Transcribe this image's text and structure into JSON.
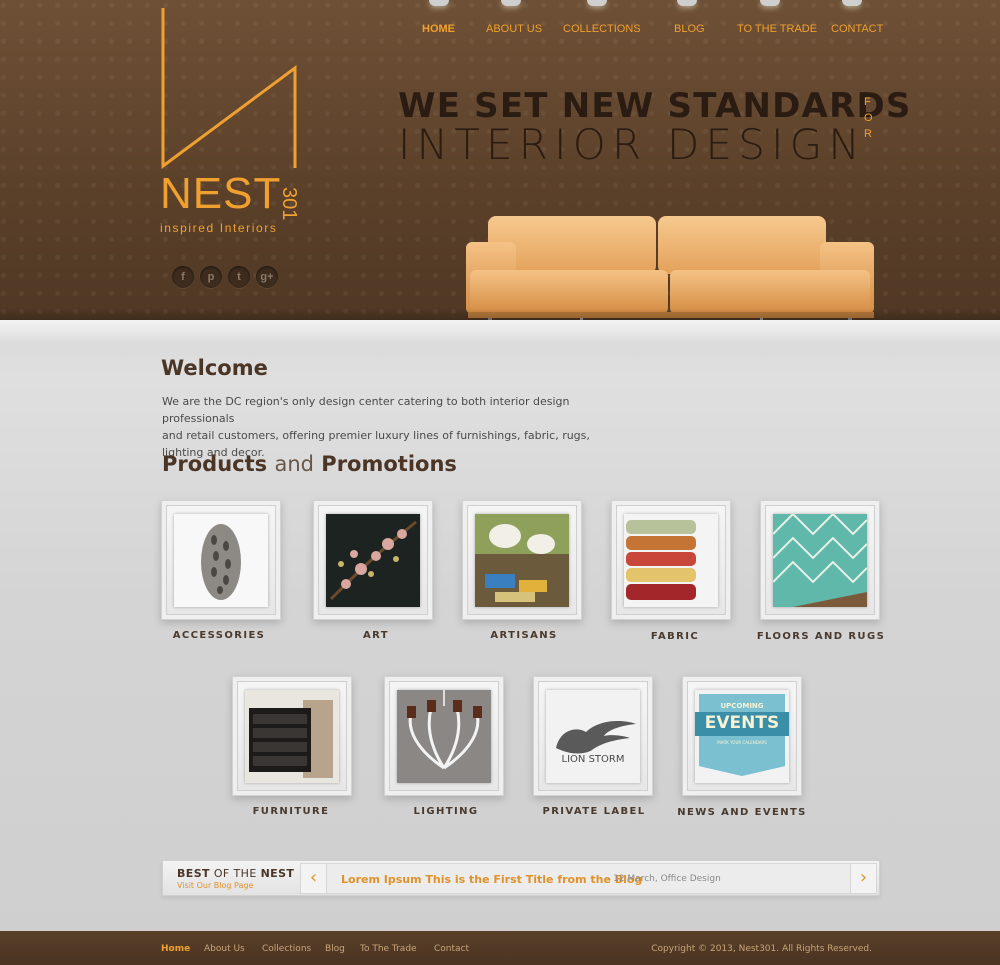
{
  "brand": {
    "name": "NEST",
    "number": "301",
    "tagline": "inspired Interiors",
    "accent": "#f0a030",
    "background": "#5b4029"
  },
  "social": [
    {
      "name": "facebook-icon",
      "glyph": "f"
    },
    {
      "name": "pinterest-icon",
      "glyph": "p"
    },
    {
      "name": "twitter-icon",
      "glyph": "t"
    },
    {
      "name": "google-plus-icon",
      "glyph": "g+"
    }
  ],
  "nav": {
    "items": [
      {
        "label": "HOME",
        "active": true
      },
      {
        "label": "ABOUT US",
        "active": false
      },
      {
        "label": "COLLECTIONS",
        "active": false
      },
      {
        "label": "BLOG",
        "active": false
      },
      {
        "label": "TO THE TRADE",
        "active": false
      },
      {
        "label": "CONTACT",
        "active": false
      }
    ]
  },
  "hero": {
    "line1": "WE SET NEW STANDARDS",
    "line2": "INTERIOR DESIGN",
    "vertical": "FOR"
  },
  "welcome": {
    "title": "Welcome",
    "line1": "We are the DC region's only design center catering to both interior design professionals",
    "line2": "and retail customers, offering premier luxury lines of furnishings, fabric, rugs, lighting and decor."
  },
  "products": {
    "title_bold1": "Products",
    "title_light": "and",
    "title_bold2": "Promotions",
    "items": [
      {
        "label": "ACCESSORIES"
      },
      {
        "label": "ART"
      },
      {
        "label": "ARTISANS"
      },
      {
        "label": "FABRIC"
      },
      {
        "label": "FLOORS AND RUGS"
      },
      {
        "label": "FURNITURE"
      },
      {
        "label": "LIGHTING"
      },
      {
        "label": "PRIVATE LABEL",
        "logo_text": "LION STORM"
      },
      {
        "label": "NEWS AND EVENTS",
        "badge_top": "UPCOMING",
        "badge_main": "EVENTS",
        "badge_sub": "MARK YOUR CALENDARS"
      }
    ]
  },
  "blog": {
    "best_bold1": "BEST",
    "best_light": "OF THE",
    "best_bold2": "NEST",
    "visit": "Visit Our Blog Page",
    "headline": "Lorem Ipsum This is the First Title from the Blog",
    "meta": "- 12 March, Office Design",
    "prev_glyph": "‹",
    "next_glyph": "›"
  },
  "footer": {
    "links": [
      {
        "label": "Home",
        "active": true
      },
      {
        "label": "About Us",
        "active": false
      },
      {
        "label": "Collections",
        "active": false
      },
      {
        "label": "Blog",
        "active": false
      },
      {
        "label": "To The Trade",
        "active": false
      },
      {
        "label": "Contact",
        "active": false
      }
    ],
    "copyright": "Copyright © 2013, Nest301. All Rights Reserved."
  }
}
